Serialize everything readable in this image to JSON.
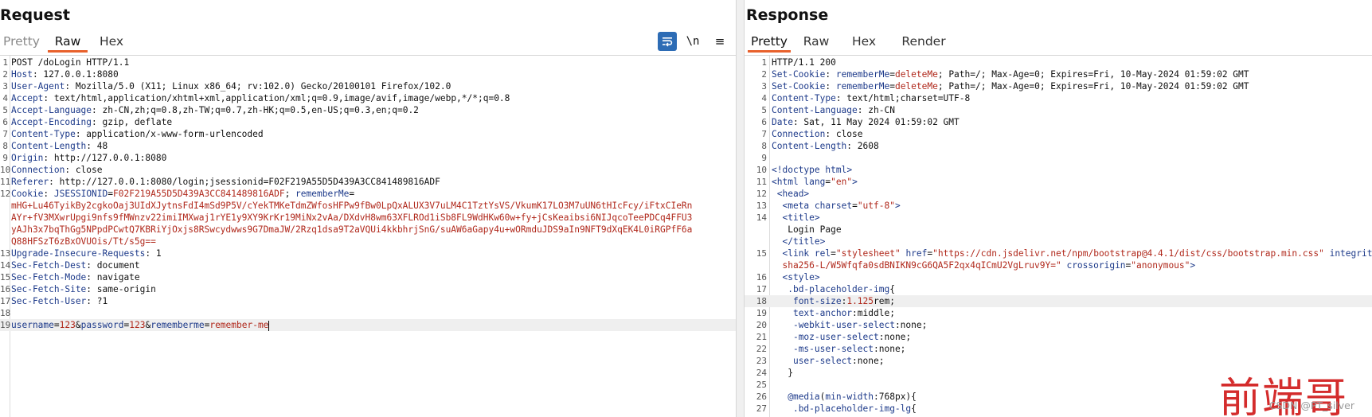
{
  "request": {
    "title": "Request",
    "tabs": [
      "Pretty",
      "Raw",
      "Hex"
    ],
    "active_tab": "Raw",
    "toolbar": {
      "wrap_icon": "wrap-lines-icon",
      "newline_label": "\\n",
      "menu_label": "≡"
    },
    "lines": [
      {
        "n": "1",
        "parts": [
          [
            "hv",
            "POST /doLogin HTTP/1.1"
          ]
        ]
      },
      {
        "n": "2",
        "parts": [
          [
            "hk",
            "Host"
          ],
          [
            "hv",
            ": 127.0.0.1:8080"
          ]
        ]
      },
      {
        "n": "3",
        "parts": [
          [
            "hk",
            "User-Agent"
          ],
          [
            "hv",
            ": Mozilla/5.0 (X11; Linux x86_64; rv:102.0) Gecko/20100101 Firefox/102.0"
          ]
        ]
      },
      {
        "n": "4",
        "parts": [
          [
            "hk",
            "Accept"
          ],
          [
            "hv",
            ": text/html,application/xhtml+xml,application/xml;q=0.9,image/avif,image/webp,*/*;q=0.8"
          ]
        ]
      },
      {
        "n": "5",
        "parts": [
          [
            "hk",
            "Accept-Language"
          ],
          [
            "hv",
            ": zh-CN,zh;q=0.8,zh-TW;q=0.7,zh-HK;q=0.5,en-US;q=0.3,en;q=0.2"
          ]
        ]
      },
      {
        "n": "6",
        "parts": [
          [
            "hk",
            "Accept-Encoding"
          ],
          [
            "hv",
            ": gzip, deflate"
          ]
        ]
      },
      {
        "n": "7",
        "parts": [
          [
            "hk",
            "Content-Type"
          ],
          [
            "hv",
            ": application/x-www-form-urlencoded"
          ]
        ]
      },
      {
        "n": "8",
        "parts": [
          [
            "hk",
            "Content-Length"
          ],
          [
            "hv",
            ": 48"
          ]
        ]
      },
      {
        "n": "9",
        "parts": [
          [
            "hk",
            "Origin"
          ],
          [
            "hv",
            ": http://127.0.0.1:8080"
          ]
        ]
      },
      {
        "n": "10",
        "parts": [
          [
            "hk",
            "Connection"
          ],
          [
            "hv",
            ": close"
          ]
        ]
      },
      {
        "n": "11",
        "parts": [
          [
            "hk",
            "Referer"
          ],
          [
            "hv",
            ": http://127.0.0.1:8080/login;jsessionid=F02F219A55D5D439A3CC841489816ADF"
          ]
        ]
      },
      {
        "n": "12",
        "parts": [
          [
            "hk",
            "Cookie"
          ],
          [
            "hv",
            ": "
          ],
          [
            "hk",
            "JSESSIONID"
          ],
          [
            "hv",
            "="
          ],
          [
            "red",
            "F02F219A55D5D439A3CC841489816ADF"
          ],
          [
            "hv",
            "; "
          ],
          [
            "hk",
            "rememberMe"
          ],
          [
            "hv",
            "="
          ]
        ]
      },
      {
        "n": "",
        "parts": [
          [
            "red",
            "mHG+Lu46TyikBy2cgkoOaj3UIdXJytnsFdI4mSd9P5V/cYekTMKeTdmZWfosHFPw9fBw0LpQxALUX3V7uLM4C1TztYsVS/VkumK17LO3M7uUN6tHIcFcy/iFtxCIeRn"
          ]
        ]
      },
      {
        "n": "",
        "parts": [
          [
            "red",
            "AYr+fV3MXwrUpgi9nfs9fMWnzv22imiIMXwaj1rYE1y9XY9KrKr19MiNx2vAa/DXdvH8wm63XFLROd1iSb8FL9WdHKw60w+fy+jCsKeaibsi6NIJqcoTeePDCq4FFU3"
          ]
        ]
      },
      {
        "n": "",
        "parts": [
          [
            "red",
            "yAJh3x7bqThGg5NPpdPCwtQ7KBRiYjOxjs8RSwcydwws9G7DmaJW/2Rzq1dsa9T2aVQUi4kkbhrjSnG/suAW6aGapy4u+wORmduJDS9aIn9NFT9dXqEK4L0iRGPfF6a"
          ]
        ]
      },
      {
        "n": "",
        "parts": [
          [
            "red",
            "Q88HFSzT6zBxOVUOis/Tt/s5g=="
          ]
        ]
      },
      {
        "n": "13",
        "parts": [
          [
            "hk",
            "Upgrade-Insecure-Requests"
          ],
          [
            "hv",
            ": 1"
          ]
        ]
      },
      {
        "n": "14",
        "parts": [
          [
            "hk",
            "Sec-Fetch-Dest"
          ],
          [
            "hv",
            ": document"
          ]
        ]
      },
      {
        "n": "15",
        "parts": [
          [
            "hk",
            "Sec-Fetch-Mode"
          ],
          [
            "hv",
            ": navigate"
          ]
        ]
      },
      {
        "n": "16",
        "parts": [
          [
            "hk",
            "Sec-Fetch-Site"
          ],
          [
            "hv",
            ": same-origin"
          ]
        ]
      },
      {
        "n": "17",
        "parts": [
          [
            "hk",
            "Sec-Fetch-User"
          ],
          [
            "hv",
            ": ?1"
          ]
        ]
      },
      {
        "n": "18",
        "parts": []
      },
      {
        "n": "19",
        "parts": [
          [
            "pk",
            "username"
          ],
          [
            "hv",
            "="
          ],
          [
            "pv",
            "123"
          ],
          [
            "hv",
            "&"
          ],
          [
            "pk",
            "password"
          ],
          [
            "hv",
            "="
          ],
          [
            "pv",
            "123"
          ],
          [
            "hv",
            "&"
          ],
          [
            "pk",
            "rememberme"
          ],
          [
            "hv",
            "="
          ],
          [
            "pv",
            "remember-me"
          ]
        ],
        "current": true
      }
    ]
  },
  "response": {
    "title": "Response",
    "tabs": [
      "Pretty",
      "Raw",
      "Hex",
      "Render"
    ],
    "active_tab": "Pretty",
    "lines": [
      {
        "n": "1",
        "parts": [
          [
            "hv",
            "HTTP/1.1 200"
          ]
        ]
      },
      {
        "n": "2",
        "parts": [
          [
            "hk",
            "Set-Cookie"
          ],
          [
            "hv",
            ": "
          ],
          [
            "hk",
            "rememberMe"
          ],
          [
            "hv",
            "="
          ],
          [
            "red",
            "deleteMe"
          ],
          [
            "hv",
            "; Path=/; Max-Age=0; Expires=Fri, 10-May-2024 01:59:02 GMT"
          ]
        ]
      },
      {
        "n": "3",
        "parts": [
          [
            "hk",
            "Set-Cookie"
          ],
          [
            "hv",
            ": "
          ],
          [
            "hk",
            "rememberMe"
          ],
          [
            "hv",
            "="
          ],
          [
            "red",
            "deleteMe"
          ],
          [
            "hv",
            "; Path=/; Max-Age=0; Expires=Fri, 10-May-2024 01:59:02 GMT"
          ]
        ]
      },
      {
        "n": "4",
        "parts": [
          [
            "hk",
            "Content-Type"
          ],
          [
            "hv",
            ": text/html;charset=UTF-8"
          ]
        ]
      },
      {
        "n": "5",
        "parts": [
          [
            "hk",
            "Content-Language"
          ],
          [
            "hv",
            ": zh-CN"
          ]
        ]
      },
      {
        "n": "6",
        "parts": [
          [
            "hk",
            "Date"
          ],
          [
            "hv",
            ": Sat, 11 May 2024 01:59:02 GMT"
          ]
        ]
      },
      {
        "n": "7",
        "parts": [
          [
            "hk",
            "Connection"
          ],
          [
            "hv",
            ": close"
          ]
        ]
      },
      {
        "n": "8",
        "parts": [
          [
            "hk",
            "Content-Length"
          ],
          [
            "hv",
            ": 2608"
          ]
        ]
      },
      {
        "n": "9",
        "parts": []
      },
      {
        "n": "10",
        "parts": [
          [
            "tag",
            "<!doctype "
          ],
          [
            "attr",
            "html"
          ],
          [
            "tag",
            ">"
          ]
        ]
      },
      {
        "n": "11",
        "parts": [
          [
            "tag",
            "<html "
          ],
          [
            "attr",
            "lang"
          ],
          [
            "txt",
            "="
          ],
          [
            "aval",
            "\"en\""
          ],
          [
            "tag",
            ">"
          ]
        ]
      },
      {
        "n": "12",
        "parts": [
          [
            "txt",
            " "
          ],
          [
            "tag",
            "<head>"
          ]
        ]
      },
      {
        "n": "13",
        "parts": [
          [
            "txt",
            "  "
          ],
          [
            "tag",
            "<meta "
          ],
          [
            "attr",
            "charset"
          ],
          [
            "txt",
            "="
          ],
          [
            "aval",
            "\"utf-8\""
          ],
          [
            "tag",
            ">"
          ]
        ]
      },
      {
        "n": "14",
        "parts": [
          [
            "txt",
            "  "
          ],
          [
            "tag",
            "<title>"
          ]
        ]
      },
      {
        "n": "",
        "parts": [
          [
            "txt",
            "   Login Page"
          ]
        ]
      },
      {
        "n": "",
        "parts": [
          [
            "txt",
            "  "
          ],
          [
            "tag",
            "</title>"
          ]
        ]
      },
      {
        "n": "15",
        "parts": [
          [
            "txt",
            "  "
          ],
          [
            "tag",
            "<link "
          ],
          [
            "attr",
            "rel"
          ],
          [
            "txt",
            "="
          ],
          [
            "aval",
            "\"stylesheet\" "
          ],
          [
            "attr",
            "href"
          ],
          [
            "txt",
            "="
          ],
          [
            "aval",
            "\"https://cdn.jsdelivr.net/npm/bootstrap@4.4.1/dist/css/bootstrap.min.css\" "
          ],
          [
            "attr",
            "integrity"
          ]
        ]
      },
      {
        "n": "",
        "parts": [
          [
            "aval",
            "  sha256-L/W5Wfqfa0sdBNIKN9cG6QA5F2qx4qICmU2VgLruv9Y=\" "
          ],
          [
            "attr",
            "crossorigin"
          ],
          [
            "txt",
            "="
          ],
          [
            "aval",
            "\"anonymous\""
          ],
          [
            "tag",
            ">"
          ]
        ]
      },
      {
        "n": "16",
        "parts": [
          [
            "txt",
            "  "
          ],
          [
            "tag",
            "<style>"
          ]
        ]
      },
      {
        "n": "17",
        "parts": [
          [
            "txt",
            "   "
          ],
          [
            "attr",
            ".bd-placeholder-img"
          ],
          [
            "txt",
            "{"
          ]
        ]
      },
      {
        "n": "18",
        "parts": [
          [
            "txt",
            "    "
          ],
          [
            "attr",
            "font-size"
          ],
          [
            "txt",
            ":"
          ],
          [
            "aval",
            "1.125"
          ],
          [
            "txt",
            "rem;"
          ]
        ],
        "current": true
      },
      {
        "n": "19",
        "parts": [
          [
            "txt",
            "    "
          ],
          [
            "attr",
            "text-anchor"
          ],
          [
            "txt",
            ":middle;"
          ]
        ]
      },
      {
        "n": "20",
        "parts": [
          [
            "txt",
            "    "
          ],
          [
            "attr",
            "-webkit-user-select"
          ],
          [
            "txt",
            ":none;"
          ]
        ]
      },
      {
        "n": "21",
        "parts": [
          [
            "txt",
            "    "
          ],
          [
            "attr",
            "-moz-user-select"
          ],
          [
            "txt",
            ":none;"
          ]
        ]
      },
      {
        "n": "22",
        "parts": [
          [
            "txt",
            "    "
          ],
          [
            "attr",
            "-ms-user-select"
          ],
          [
            "txt",
            ":none;"
          ]
        ]
      },
      {
        "n": "23",
        "parts": [
          [
            "txt",
            "    "
          ],
          [
            "attr",
            "user-select"
          ],
          [
            "txt",
            ":none;"
          ]
        ]
      },
      {
        "n": "24",
        "parts": [
          [
            "txt",
            "   }"
          ]
        ]
      },
      {
        "n": "25",
        "parts": []
      },
      {
        "n": "26",
        "parts": [
          [
            "txt",
            "   "
          ],
          [
            "attr",
            "@media"
          ],
          [
            "txt",
            "("
          ],
          [
            "attr",
            "min-width"
          ],
          [
            "txt",
            ":768px){"
          ]
        ]
      },
      {
        "n": "27",
        "parts": [
          [
            "txt",
            "    "
          ],
          [
            "attr",
            ".bd-placeholder-img-lg"
          ],
          [
            "txt",
            "{"
          ]
        ]
      }
    ]
  },
  "watermark": {
    "text": "前端哥",
    "credit": "CSDN @PT_silver"
  },
  "colors": {
    "accent": "#e8612c",
    "key": "#1d3a8a",
    "value": "#b0281b",
    "wrap_button": "#2d6cb5"
  }
}
